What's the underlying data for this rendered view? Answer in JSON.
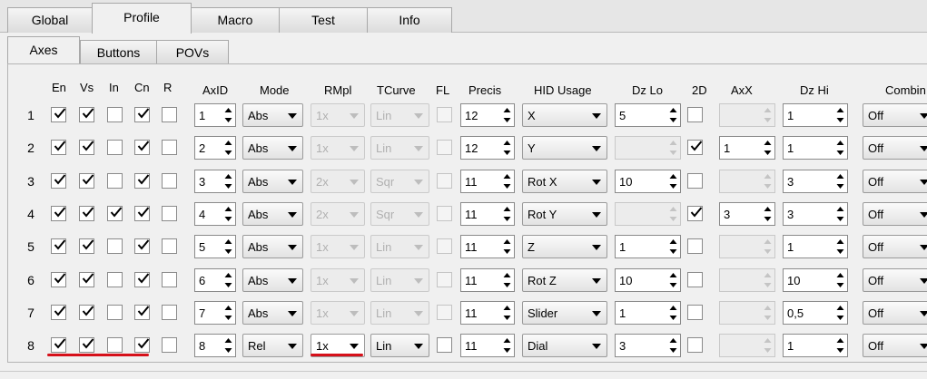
{
  "main_tabs": [
    "Global",
    "Profile",
    "Macro",
    "Test",
    "Info"
  ],
  "sub_tabs": [
    "Axes",
    "Buttons",
    "POVs"
  ],
  "headers": {
    "en": "En",
    "vs": "Vs",
    "in": "In",
    "cn": "Cn",
    "r": "R",
    "axid": "AxID",
    "mode": "Mode",
    "rmpl": "RMpl",
    "tcurve": "TCurve",
    "fl": "FL",
    "precis": "Precis",
    "hid": "HID Usage",
    "dzlo": "Dz Lo",
    "twod": "2D",
    "axx": "AxX",
    "dzhi": "Dz Hi",
    "combi": "Combin"
  },
  "rows": [
    {
      "n": "1",
      "en": true,
      "vs": true,
      "in": false,
      "cn": true,
      "r": false,
      "axid": "1",
      "mode": "Abs",
      "rmpl": "1x",
      "rmpl_enabled": false,
      "tcurve": "Lin",
      "tcurve_enabled": false,
      "fl": false,
      "fl_enabled": false,
      "precis": "12",
      "hid": "X",
      "dzlo": "5",
      "twod": false,
      "axx": "",
      "dzhi": "1",
      "combi": "Off"
    },
    {
      "n": "2",
      "en": true,
      "vs": true,
      "in": false,
      "cn": true,
      "r": false,
      "axid": "2",
      "mode": "Abs",
      "rmpl": "1x",
      "rmpl_enabled": false,
      "tcurve": "Lin",
      "tcurve_enabled": false,
      "fl": false,
      "fl_enabled": false,
      "precis": "12",
      "hid": "Y",
      "dzlo": "",
      "twod": true,
      "axx": "1",
      "dzhi": "1",
      "combi": "Off"
    },
    {
      "n": "3",
      "en": true,
      "vs": true,
      "in": false,
      "cn": true,
      "r": false,
      "axid": "3",
      "mode": "Abs",
      "rmpl": "2x",
      "rmpl_enabled": false,
      "tcurve": "Sqr",
      "tcurve_enabled": false,
      "fl": false,
      "fl_enabled": false,
      "precis": "11",
      "hid": "Rot X",
      "dzlo": "10",
      "twod": false,
      "axx": "",
      "dzhi": "3",
      "combi": "Off"
    },
    {
      "n": "4",
      "en": true,
      "vs": true,
      "in": true,
      "cn": true,
      "r": false,
      "axid": "4",
      "mode": "Abs",
      "rmpl": "2x",
      "rmpl_enabled": false,
      "tcurve": "Sqr",
      "tcurve_enabled": false,
      "fl": false,
      "fl_enabled": false,
      "precis": "11",
      "hid": "Rot Y",
      "dzlo": "",
      "twod": true,
      "axx": "3",
      "dzhi": "3",
      "combi": "Off"
    },
    {
      "n": "5",
      "en": true,
      "vs": true,
      "in": false,
      "cn": true,
      "r": false,
      "axid": "5",
      "mode": "Abs",
      "rmpl": "1x",
      "rmpl_enabled": false,
      "tcurve": "Lin",
      "tcurve_enabled": false,
      "fl": false,
      "fl_enabled": false,
      "precis": "11",
      "hid": "Z",
      "dzlo": "1",
      "twod": false,
      "axx": "",
      "dzhi": "1",
      "combi": "Off"
    },
    {
      "n": "6",
      "en": true,
      "vs": true,
      "in": false,
      "cn": true,
      "r": false,
      "axid": "6",
      "mode": "Abs",
      "rmpl": "1x",
      "rmpl_enabled": false,
      "tcurve": "Lin",
      "tcurve_enabled": false,
      "fl": false,
      "fl_enabled": false,
      "precis": "11",
      "hid": "Rot Z",
      "dzlo": "10",
      "twod": false,
      "axx": "",
      "dzhi": "10",
      "combi": "Off"
    },
    {
      "n": "7",
      "en": true,
      "vs": true,
      "in": false,
      "cn": true,
      "r": false,
      "axid": "7",
      "mode": "Abs",
      "rmpl": "1x",
      "rmpl_enabled": false,
      "tcurve": "Lin",
      "tcurve_enabled": false,
      "fl": false,
      "fl_enabled": false,
      "precis": "11",
      "hid": "Slider",
      "dzlo": "1",
      "twod": false,
      "axx": "",
      "dzhi": "0,5",
      "combi": "Off"
    },
    {
      "n": "8",
      "en": true,
      "vs": true,
      "in": false,
      "cn": true,
      "r": false,
      "axid": "8",
      "mode": "Rel",
      "rmpl": "1x",
      "rmpl_enabled": true,
      "tcurve": "Lin",
      "tcurve_enabled": true,
      "fl": false,
      "fl_enabled": true,
      "precis": "11",
      "hid": "Dial",
      "dzlo": "3",
      "twod": false,
      "axx": "",
      "dzhi": "1",
      "combi": "Off"
    }
  ],
  "colors": {
    "highlight_underline": "#d6101a"
  }
}
